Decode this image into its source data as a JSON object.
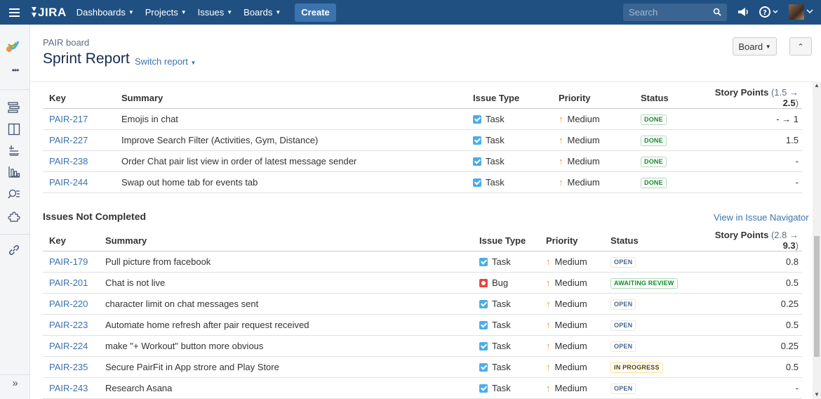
{
  "nav": {
    "logo": "JIRA",
    "items": [
      {
        "label": "Dashboards"
      },
      {
        "label": "Projects"
      },
      {
        "label": "Issues"
      },
      {
        "label": "Boards"
      }
    ],
    "create_label": "Create",
    "search_placeholder": "Search",
    "icons": [
      "menu-icon",
      "megaphone-icon",
      "help-icon",
      "avatar"
    ]
  },
  "sidebar": {
    "icons": [
      "project-avatar",
      "more-icon",
      "backlog-icon",
      "active-sprints-icon",
      "releases-icon",
      "reports-icon",
      "issues-icon",
      "components-icon",
      "add-link-icon",
      "expand-sidebar-icon"
    ],
    "more_label": "•••",
    "expand_label": "»"
  },
  "header": {
    "breadcrumb": "PAIR board",
    "title": "Sprint Report",
    "switch_label": "Switch report",
    "board_button": "Board"
  },
  "completed": {
    "columns": {
      "key": "Key",
      "summary": "Summary",
      "type": "Issue Type",
      "priority": "Priority",
      "status": "Status",
      "sp": "Story Points",
      "sp_from": "1.5",
      "sp_to": "2.5"
    },
    "rows": [
      {
        "key": "PAIR-217",
        "summary": "Emojis in chat",
        "type": "Task",
        "priority": "Medium",
        "status": "DONE",
        "sp": "- → 1"
      },
      {
        "key": "PAIR-227",
        "summary": "Improve Search Filter (Activities, Gym, Distance)",
        "type": "Task",
        "priority": "Medium",
        "status": "DONE",
        "sp": "1.5"
      },
      {
        "key": "PAIR-238",
        "summary": "Order Chat pair list view in order of latest message sender",
        "type": "Task",
        "priority": "Medium",
        "status": "DONE",
        "sp": "-"
      },
      {
        "key": "PAIR-244",
        "summary": "Swap out home tab for events tab",
        "type": "Task",
        "priority": "Medium",
        "status": "DONE",
        "sp": "-"
      }
    ]
  },
  "not_completed": {
    "title": "Issues Not Completed",
    "view_link": "View in Issue Navigator",
    "columns": {
      "key": "Key",
      "summary": "Summary",
      "type": "Issue Type",
      "priority": "Priority",
      "status": "Status",
      "sp": "Story Points",
      "sp_from": "2.8",
      "sp_to": "9.3"
    },
    "rows": [
      {
        "key": "PAIR-179",
        "summary": "Pull picture from facebook",
        "type": "Task",
        "priority": "Medium",
        "status": "OPEN",
        "sp": "0.8"
      },
      {
        "key": "PAIR-201",
        "summary": "Chat is not live",
        "type": "Bug",
        "priority": "Medium",
        "status": "AWAITING REVIEW",
        "sp": "0.5"
      },
      {
        "key": "PAIR-220",
        "summary": "character limit on chat messages sent",
        "type": "Task",
        "priority": "Medium",
        "status": "OPEN",
        "sp": "0.25"
      },
      {
        "key": "PAIR-223",
        "summary": "Automate home refresh after pair request received",
        "type": "Task",
        "priority": "Medium",
        "status": "OPEN",
        "sp": "0.5"
      },
      {
        "key": "PAIR-224",
        "summary": "make \"+ Workout\" button more obvious",
        "type": "Task",
        "priority": "Medium",
        "status": "OPEN",
        "sp": "0.25"
      },
      {
        "key": "PAIR-235",
        "summary": "Secure PairFit in App strore and Play Store",
        "type": "Task",
        "priority": "Medium",
        "status": "IN PROGRESS",
        "sp": "0.5"
      },
      {
        "key": "PAIR-243",
        "summary": "Research Asana",
        "type": "Task",
        "priority": "Medium",
        "status": "OPEN",
        "sp": "-"
      }
    ]
  },
  "colors": {
    "nav_bg": "#205081",
    "link": "#3b73af",
    "done": "#14892c",
    "priority_medium": "#f79232"
  }
}
